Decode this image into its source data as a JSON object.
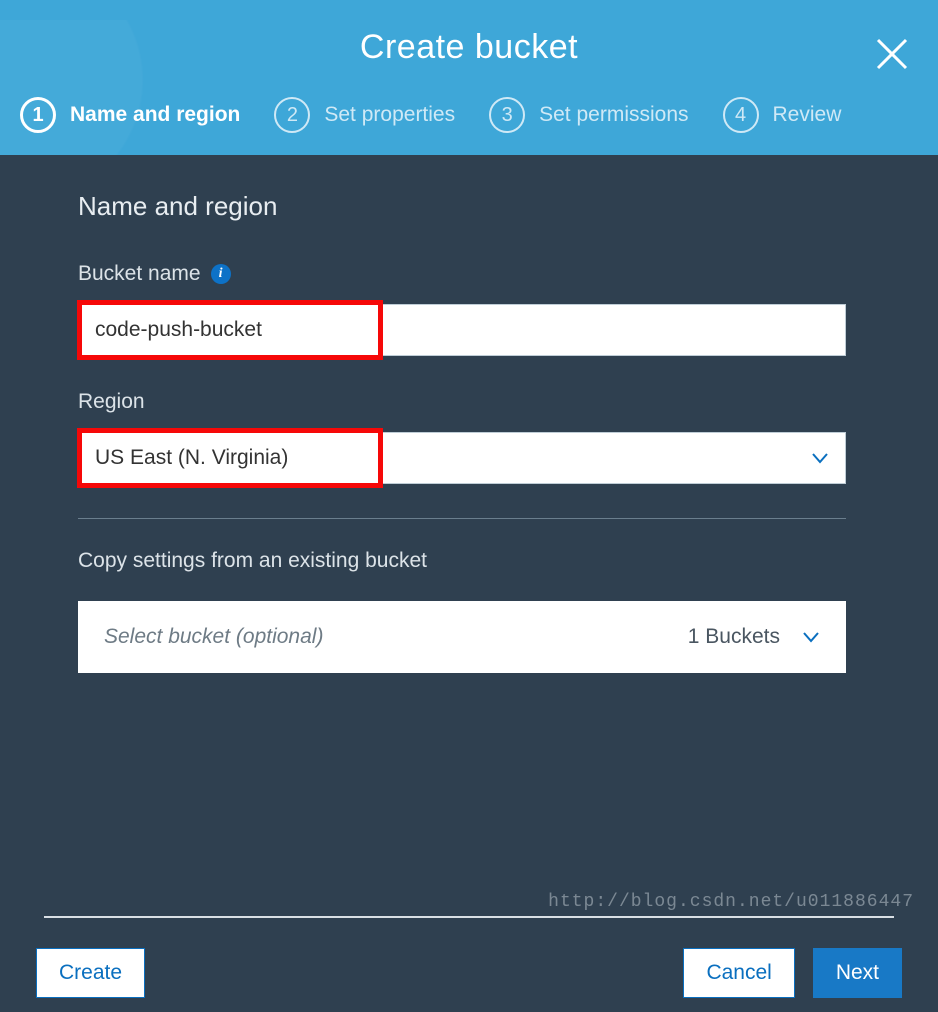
{
  "header": {
    "title": "Create bucket",
    "steps": [
      {
        "num": "1",
        "label": "Name and region",
        "active": true
      },
      {
        "num": "2",
        "label": "Set properties",
        "active": false
      },
      {
        "num": "3",
        "label": "Set permissions",
        "active": false
      },
      {
        "num": "4",
        "label": "Review",
        "active": false
      }
    ]
  },
  "form": {
    "section_title": "Name and region",
    "bucket_name_label": "Bucket name",
    "bucket_name_value": "code-push-bucket",
    "region_label": "Region",
    "region_value": "US East (N. Virginia)",
    "copy_label": "Copy settings from an existing bucket",
    "copy_placeholder": "Select bucket (optional)",
    "copy_count": "1 Buckets"
  },
  "footer": {
    "create": "Create",
    "cancel": "Cancel",
    "next": "Next"
  },
  "watermark": "http://blog.csdn.net/u011886447"
}
